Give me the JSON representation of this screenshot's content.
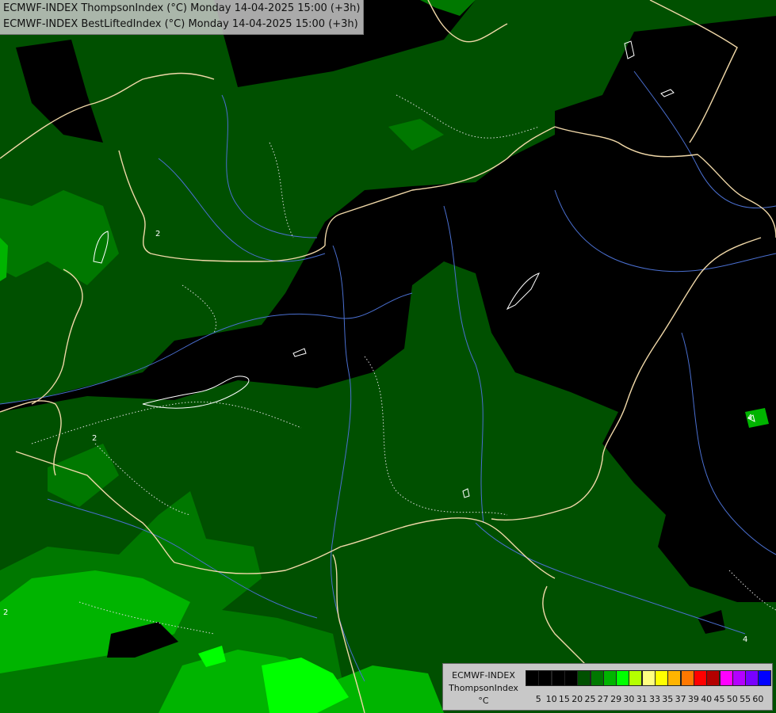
{
  "header": {
    "line1": "ECMWF-INDEX ThompsonIndex (°C) Monday 14-04-2025 15:00 (+3h)",
    "line2": "ECMWF-INDEX BestLiftedIndex (°C) Monday 14-04-2025 15:00 (+3h)"
  },
  "contour_labels": [
    "2",
    "2",
    "2",
    "4",
    "4"
  ],
  "legend": {
    "model": "ECMWF-INDEX",
    "parameter": "ThompsonIndex",
    "unit": "°C",
    "ticks": [
      "5",
      "10",
      "15",
      "20",
      "25",
      "27",
      "29",
      "30",
      "31",
      "33",
      "35",
      "37",
      "39",
      "40",
      "45",
      "50",
      "55",
      "60"
    ],
    "colors": [
      "#000000",
      "#000000",
      "#000000",
      "#000000",
      "#005000",
      "#007800",
      "#00b400",
      "#00ff00",
      "#b4ff00",
      "#ffff80",
      "#ffff00",
      "#ffb400",
      "#ff7800",
      "#ff0000",
      "#b40000",
      "#ff00ff",
      "#b400ff",
      "#7800ff",
      "#0000ff"
    ]
  },
  "map_colors": {
    "background": "#000000",
    "dark_green": "#005000",
    "mid_green": "#007800",
    "bright_green": "#00b400",
    "light_green": "#00ff00",
    "border": "#f0d8a8",
    "river": "#4a6fd0",
    "contour": "#ffffff"
  }
}
